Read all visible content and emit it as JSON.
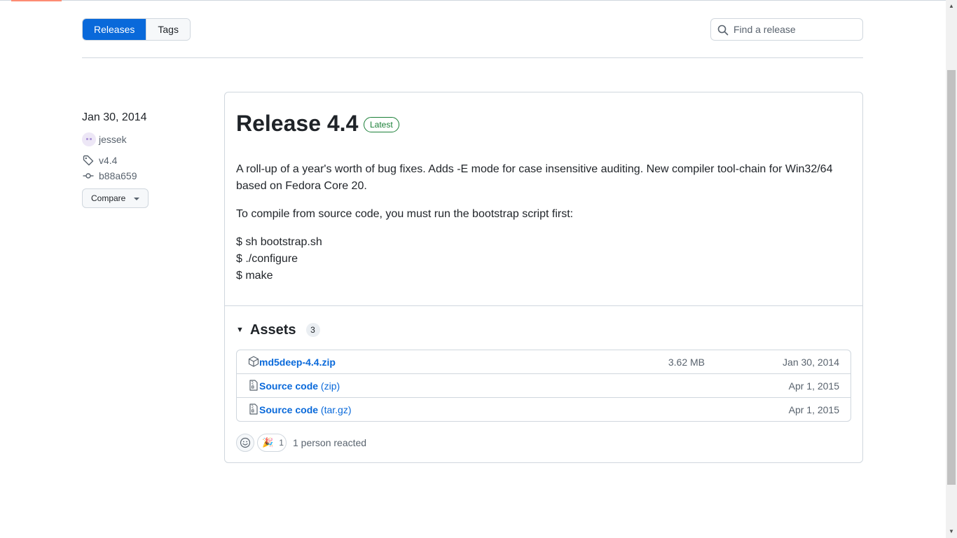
{
  "nav": {
    "releases_label": "Releases",
    "tags_label": "Tags"
  },
  "search": {
    "placeholder": "Find a release"
  },
  "meta": {
    "date": "Jan 30, 2014",
    "author": "jessek",
    "tag": "v4.4",
    "commit": "b88a659",
    "compare_label": "Compare"
  },
  "release": {
    "title": "Release 4.4",
    "badge": "Latest",
    "body_lines": [
      "A roll-up of a year's worth of bug fixes. Adds -E mode for case insensitive auditing. New compiler tool-chain for Win32/64",
      "based on Fedora Core 20.",
      "To compile from source code, you must run the bootstrap script first:",
      "$ sh bootstrap.sh",
      "$ ./configure",
      "$ make"
    ]
  },
  "assets": {
    "label": "Assets",
    "count": "3",
    "items": [
      {
        "name": "md5deep-4.4.zip",
        "format": "",
        "size": "3.62 MB",
        "date": "Jan 30, 2014",
        "icon": "package-icon"
      },
      {
        "name": "Source code",
        "format": "(zip)",
        "size": "",
        "date": "Apr 1, 2015",
        "icon": "file-zip-icon"
      },
      {
        "name": "Source code",
        "format": "(tar.gz)",
        "size": "",
        "date": "Apr 1, 2015",
        "icon": "file-zip-icon"
      }
    ]
  },
  "reactions": {
    "emoji": "🎉",
    "count": "1",
    "summary": "1 person reacted"
  },
  "colors": {
    "accent": "#0969da",
    "latest_green": "#1a7f37",
    "tab_underline": "#fd8c73"
  }
}
